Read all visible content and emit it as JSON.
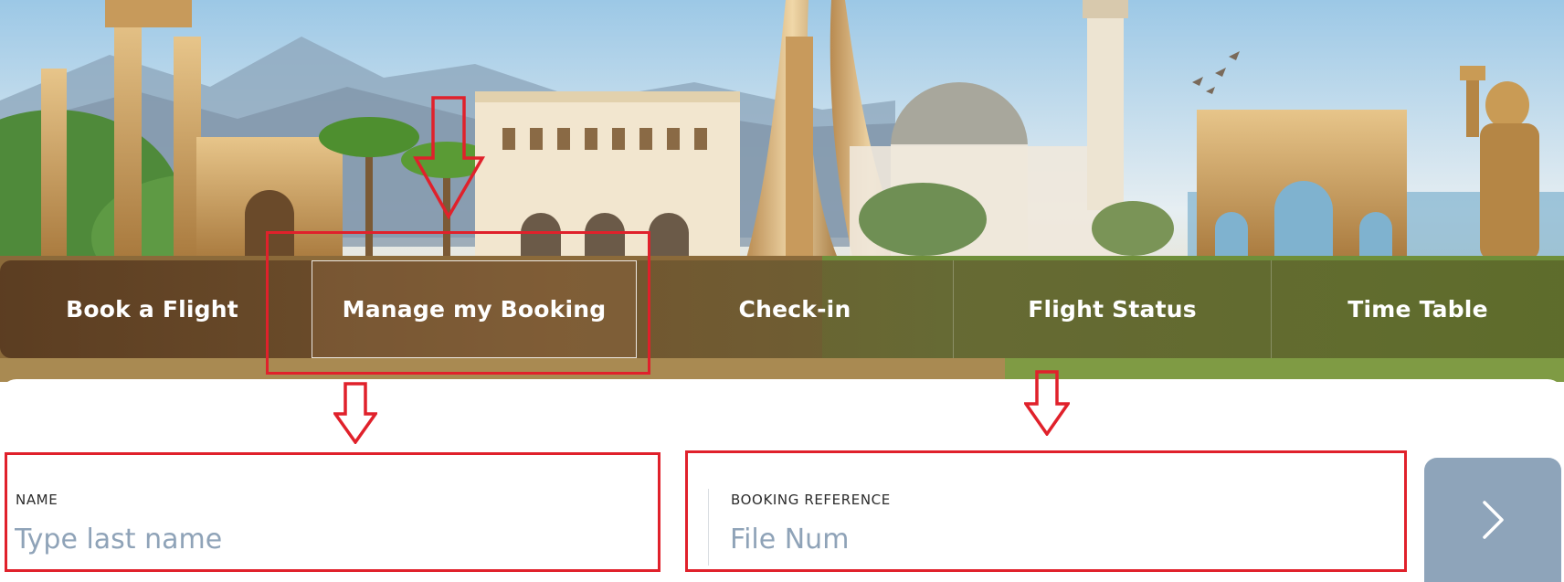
{
  "tabs": [
    {
      "label": "Book a Flight"
    },
    {
      "label": "Manage my Booking"
    },
    {
      "label": "Check-in"
    },
    {
      "label": "Flight Status"
    },
    {
      "label": "Time Table"
    }
  ],
  "active_tab": "Manage my Booking",
  "form": {
    "name": {
      "label": "NAME",
      "placeholder": "Type last name",
      "value": ""
    },
    "booking_reference": {
      "label": "BOOKING REFERENCE",
      "placeholder": "File Num",
      "value": ""
    },
    "submit_icon": "chevron-right-icon"
  },
  "colors": {
    "annotation": "#e0212b",
    "submit_button": "#8ea4ba",
    "placeholder": "#8fa3b8"
  }
}
